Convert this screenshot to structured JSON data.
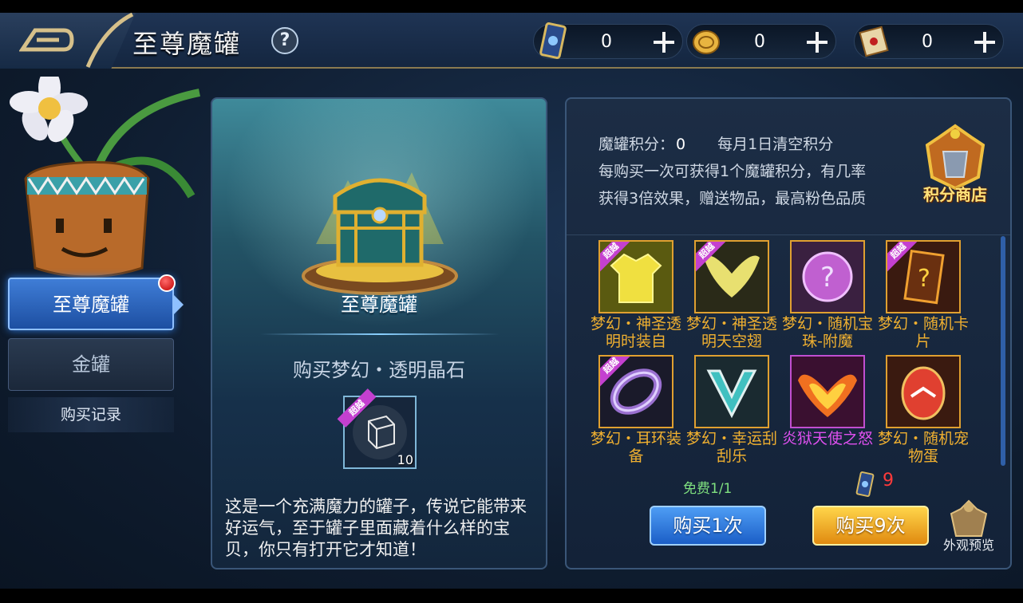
{
  "header": {
    "title": "至尊魔罐",
    "help_symbol": "?"
  },
  "currencies": [
    {
      "icon": "card-icon",
      "value": "0"
    },
    {
      "icon": "coin-icon",
      "value": "0"
    },
    {
      "icon": "scroll-icon",
      "value": "0"
    }
  ],
  "sidebar": {
    "tabs": [
      {
        "label": "至尊魔罐",
        "active": true,
        "has_notification": true
      },
      {
        "label": "金罐",
        "active": false
      }
    ],
    "records_label": "购买记录"
  },
  "center": {
    "chest_name": "至尊魔罐",
    "buy_item_label": "购买梦幻・透明晶石",
    "buy_item_tag": "超越",
    "buy_item_quantity": "10",
    "description": "这是一个充满魔力的罐子，传说它能带来好运气，至于罐子里面藏着什么样的宝贝，你只有打开它才知道！"
  },
  "right": {
    "score_label": "魔罐积分：",
    "score_value": "0",
    "score_reset_note": "每月1日清空积分",
    "score_info": "每购买一次可获得1个魔罐积分，有几率获得3倍效果，赠送物品，最高粉色品质",
    "shop_label": "积分商店",
    "items": [
      {
        "name": "梦幻・神圣透明时装自",
        "tag": "超越",
        "rarity": "gold",
        "icon": "shirt-icon"
      },
      {
        "name": "梦幻・神圣透明天空翅",
        "tag": "超越",
        "rarity": "gold",
        "icon": "wings-icon"
      },
      {
        "name": "梦幻・随机宝珠-附魔",
        "tag": "",
        "rarity": "gold",
        "icon": "orb-icon"
      },
      {
        "name": "梦幻・随机卡片",
        "tag": "超越",
        "rarity": "gold",
        "icon": "card-question-icon"
      },
      {
        "name": "梦幻・耳环装备",
        "tag": "超越",
        "rarity": "gold",
        "icon": "earring-icon"
      },
      {
        "name": "梦幻・幸运刮刮乐",
        "tag": "",
        "rarity": "gold",
        "icon": "v-badge-icon"
      },
      {
        "name": "炎狱天使之怒",
        "tag": "",
        "rarity": "purple",
        "icon": "fire-wings-icon"
      },
      {
        "name": "梦幻・随机宠物蛋",
        "tag": "",
        "rarity": "gold",
        "icon": "egg-icon"
      }
    ],
    "free_text": "免费1/1",
    "nine_cost": "9",
    "buy_once_label": "购买1次",
    "buy_nine_label": "购买9次",
    "preview_label": "外观预览"
  }
}
